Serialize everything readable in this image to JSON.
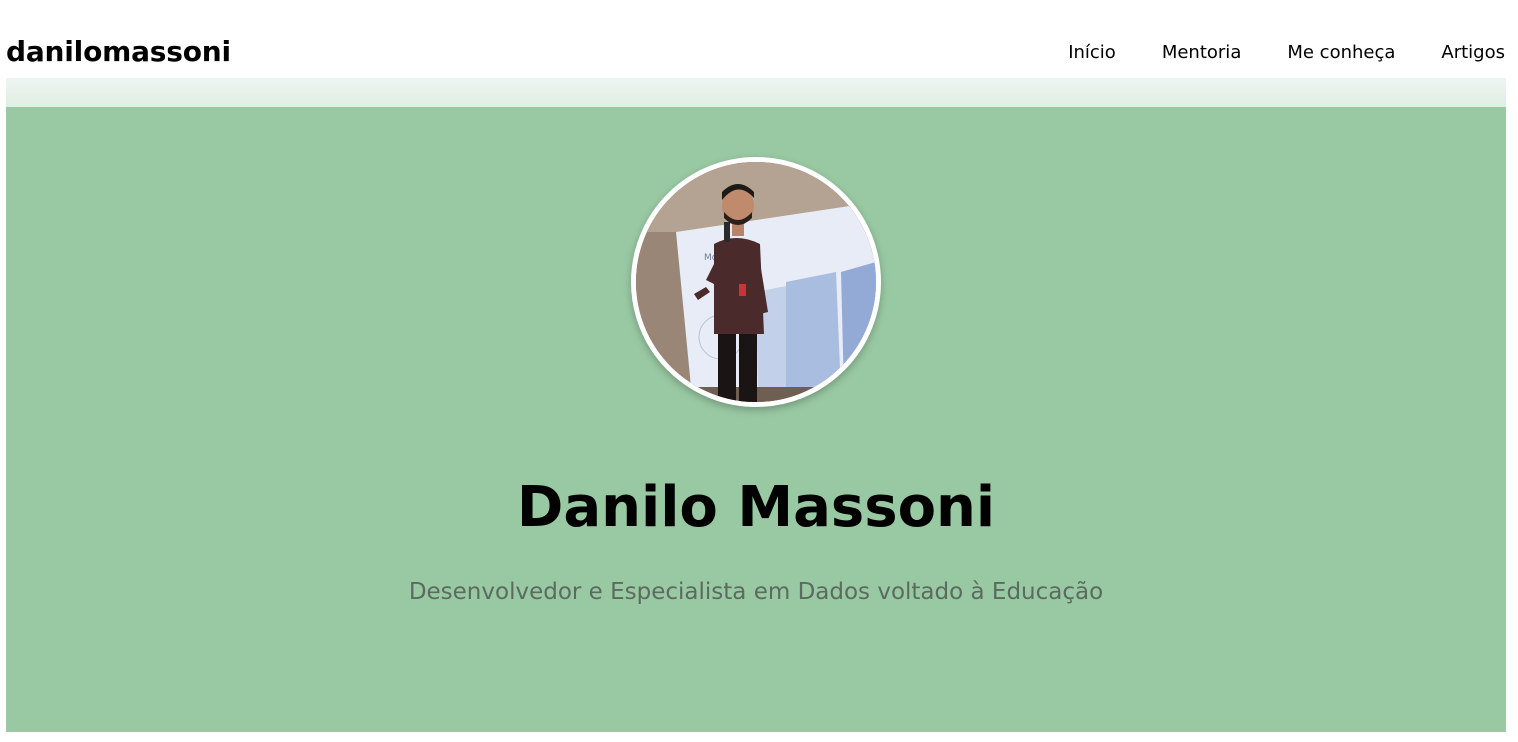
{
  "header": {
    "brand": "danilomassoni",
    "nav": [
      {
        "label": "Início"
      },
      {
        "label": "Mentoria"
      },
      {
        "label": "Me conheça"
      },
      {
        "label": "Artigos"
      }
    ]
  },
  "hero": {
    "name": "Danilo Massoni",
    "subtitle": "Desenvolvedor e Especialista em Dados voltado à Educação",
    "avatar": "profile-photo-speaker-on-stage",
    "background_color": "#99c9a3"
  }
}
